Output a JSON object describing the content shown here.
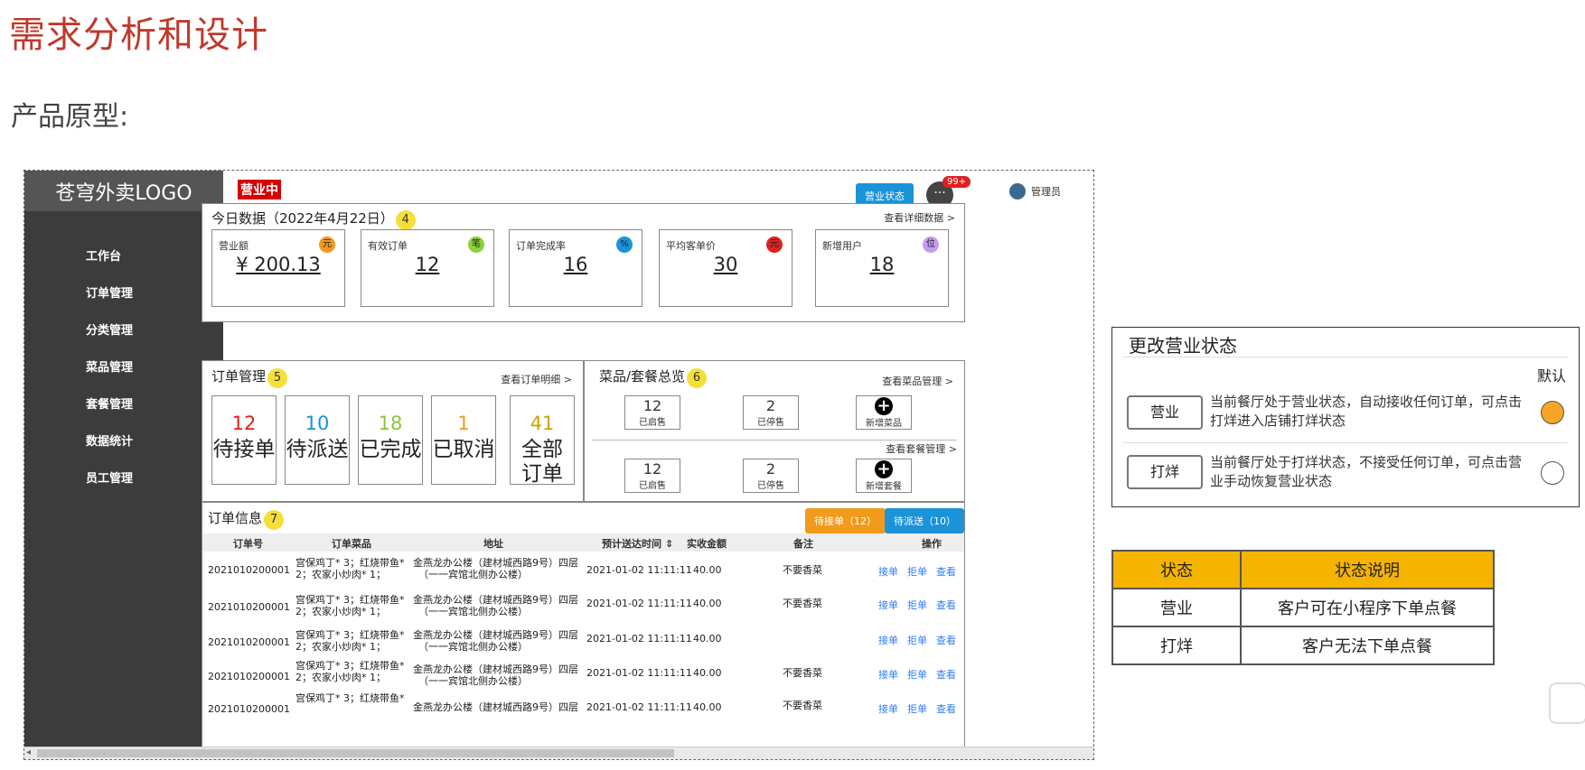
{
  "slide": {
    "title": "需求分析和设计",
    "subtitle": "产品原型:"
  },
  "sidebar": {
    "logo": "苍穹外卖LOGO",
    "items": [
      "工作台",
      "订单管理",
      "分类管理",
      "菜品管理",
      "套餐管理",
      "数据统计",
      "员工管理"
    ]
  },
  "header": {
    "status_tag": "营业中",
    "status_button": "营业状态",
    "message_icon": "···",
    "message_badge": "99+",
    "user": "管理员"
  },
  "today": {
    "title": "今日数据（2022年4月22日）",
    "badge": "4",
    "link": "查看详细数据",
    "cards": [
      {
        "label": "营业额",
        "value": "¥ 200.13",
        "icon": "元",
        "color": "#f19a1c"
      },
      {
        "label": "有效订单",
        "value": "12",
        "icon": "笔",
        "color": "#8bd33a"
      },
      {
        "label": "订单完成率",
        "value": "16",
        "icon": "%",
        "color": "#1a93d8"
      },
      {
        "label": "平均客单价",
        "value": "30",
        "icon": "元",
        "color": "#e02020"
      },
      {
        "label": "新增用户",
        "value": "18",
        "icon": "位",
        "color": "#c59bf0"
      }
    ]
  },
  "orders": {
    "title": "订单管理",
    "badge": "5",
    "link": "查看订单明细",
    "boxes": [
      {
        "num": "12",
        "label": "待接单",
        "color": "#e02020"
      },
      {
        "num": "10",
        "label": "待派送",
        "color": "#1a93d8"
      },
      {
        "num": "18",
        "label": "已完成",
        "color": "#8bc53a"
      },
      {
        "num": "1",
        "label": "已取消",
        "color": "#f19a1c"
      },
      {
        "num": "41",
        "label": "全部订单",
        "color": "#c9a500"
      }
    ]
  },
  "dishes": {
    "title": "菜品/套餐总览",
    "badge": "6",
    "link_dish": "查看菜品管理",
    "link_set": "查看套餐管理",
    "dish_on": {
      "num": "12",
      "label": "已启售"
    },
    "dish_off": {
      "num": "2",
      "label": "已停售"
    },
    "dish_add": "新增菜品",
    "set_on": {
      "num": "12",
      "label": "已启售"
    },
    "set_off": {
      "num": "2",
      "label": "已停售"
    },
    "set_add": "新增套餐"
  },
  "order_info": {
    "title": "订单信息",
    "badge": "7",
    "btn_pending": "待接单（12）",
    "btn_delivery": "待派送（10）",
    "columns": [
      "订单号",
      "订单菜品",
      "地址",
      "预计送达时间 ⇕",
      "实收金额",
      "备注",
      "操作"
    ],
    "rows": [
      {
        "id": "2021010200001",
        "dish1": "宫保鸡丁* 3；红烧带鱼*",
        "dish2": "2；农家小炒肉* 1；",
        "addr1": "金燕龙办公楼（建材城西路9号）四层",
        "addr2": "（一一宾馆北侧办公楼）",
        "time": "2021-01-02 11:11:11",
        "amount": "40.00",
        "note": "不要香菜"
      },
      {
        "id": "2021010200001",
        "dish1": "宫保鸡丁* 3；红烧带鱼*",
        "dish2": "2；农家小炒肉* 1；",
        "addr1": "金燕龙办公楼（建材城西路9号）四层",
        "addr2": "（一一宾馆北侧办公楼）",
        "time": "2021-01-02 11:11:11",
        "amount": "40.00",
        "note": "不要香菜"
      },
      {
        "id": "2021010200001",
        "dish1": "宫保鸡丁* 3；红烧带鱼*",
        "dish2": "2；农家小炒肉* 1；",
        "addr1": "金燕龙办公楼（建材城西路9号）四层",
        "addr2": "（一一宾馆北侧办公楼）",
        "time": "2021-01-02 11:11:11",
        "amount": "40.00",
        "note": ""
      },
      {
        "id": "2021010200001",
        "dish1": "宫保鸡丁* 3；红烧带鱼*",
        "dish2": "2；农家小炒肉* 1；",
        "addr1": "金燕龙办公楼（建材城西路9号）四层",
        "addr2": "（一一宾馆北侧办公楼）",
        "time": "2021-01-02 11:11:11",
        "amount": "40.00",
        "note": "不要香菜"
      },
      {
        "id": "2021010200001",
        "dish1": "宫保鸡丁* 3；红烧带鱼*",
        "dish2": "",
        "addr1": "金燕龙办公楼（建材城西路9号）四层",
        "addr2": "",
        "time": "2021-01-02 11:11:11",
        "amount": "40.00",
        "note": "不要香菜"
      }
    ],
    "ops": [
      "接单",
      "拒单",
      "查看"
    ]
  },
  "dialog": {
    "title": "更改营业状态",
    "default_label": "默认",
    "open_label": "营业",
    "open_desc": "当前餐厅处于营业状态，自动接收任何订单，可点击打烊进入店铺打烊状态",
    "close_label": "打烊",
    "close_desc": "当前餐厅处于打烊状态，不接受任何订单，可点击营业手动恢复营业状态",
    "selected": "营业",
    "accent": "#f5a623"
  },
  "status_table": {
    "headers": [
      "状态",
      "状态说明"
    ],
    "rows": [
      [
        "营业",
        "客户可在小程序下单点餐"
      ],
      [
        "打烊",
        "客户无法下单点餐"
      ]
    ]
  }
}
